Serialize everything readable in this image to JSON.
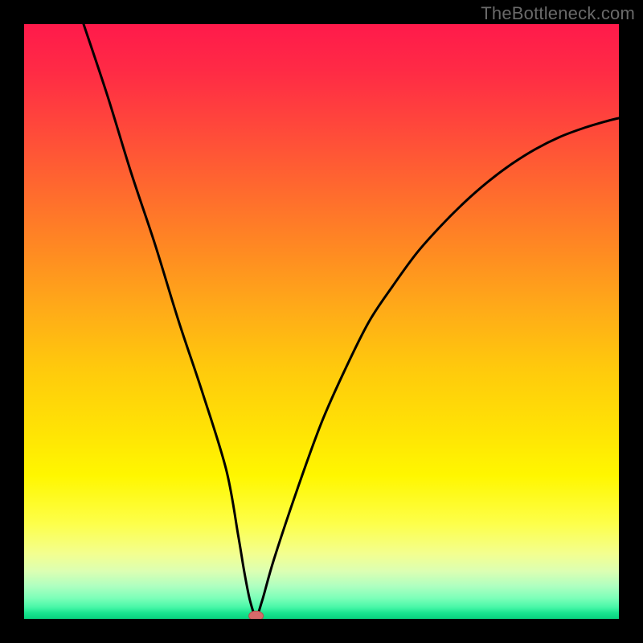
{
  "watermark": "TheBottleneck.com",
  "chart_data": {
    "type": "line",
    "title": "",
    "xlabel": "",
    "ylabel": "",
    "xlim": [
      0,
      100
    ],
    "ylim": [
      0,
      100
    ],
    "grid": false,
    "legend": false,
    "series": [
      {
        "name": "bottleneck-curve",
        "x": [
          10,
          14,
          18,
          22,
          26,
          30,
          34,
          36,
          37,
          38,
          39,
          40,
          42,
          46,
          50,
          54,
          58,
          62,
          66,
          70,
          74,
          78,
          82,
          86,
          90,
          94,
          98,
          100
        ],
        "y": [
          100,
          88,
          75,
          63,
          50,
          38,
          25,
          14,
          8,
          3,
          0.5,
          3,
          10,
          22,
          33,
          42,
          50,
          56,
          61.5,
          66,
          70,
          73.5,
          76.5,
          79,
          81,
          82.5,
          83.7,
          84.2
        ]
      }
    ],
    "marker": {
      "x": 39,
      "y": 0.5
    },
    "colors": {
      "curve": "#000000",
      "marker": "#d66a6a",
      "gradient_top": "#ff1a4b",
      "gradient_bottom": "#08d27f"
    }
  }
}
